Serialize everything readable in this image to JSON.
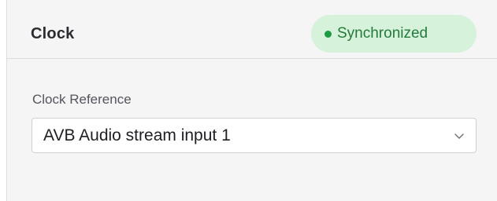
{
  "panel": {
    "title": "Clock",
    "status_badge": {
      "label": "Synchronized",
      "dot_color": "#1f9a44",
      "background": "#d7f2da",
      "text_color": "#237a3b"
    }
  },
  "clock_reference": {
    "label": "Clock Reference",
    "selected_value": "AVB Audio stream input 1",
    "chevron_icon": "chevron-down-icon"
  }
}
